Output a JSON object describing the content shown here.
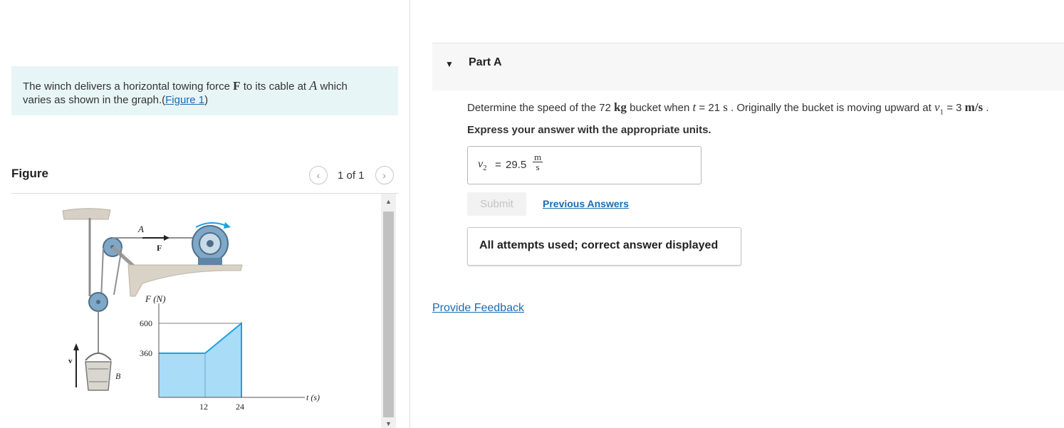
{
  "problem": {
    "text_before_F": "The winch delivers a horizontal towing force",
    "sym_F": "F",
    "text_mid": "to its cable at",
    "sym_A": "A",
    "text_line1_end": "which",
    "text_line2": "varies as shown in the graph.(",
    "figure_link": "Figure 1",
    "text_close": ")"
  },
  "figure_panel": {
    "title": "Figure",
    "pager_text": "1 of 1",
    "prev_icon": "chevron-left-icon",
    "next_icon": "chevron-right-icon"
  },
  "figure": {
    "label_A": "A",
    "label_F": "F",
    "label_FN": "F (N)",
    "label_v": "v",
    "label_B": "B",
    "y_tick_600": "600",
    "y_tick_360": "360",
    "x_tick_12": "12",
    "x_tick_24": "24",
    "x_axis_label": "t (s)"
  },
  "chart_data": {
    "type": "area",
    "x": [
      0,
      12,
      24
    ],
    "y": [
      360,
      360,
      600
    ],
    "xlabel": "t (s)",
    "ylabel": "F (N)",
    "x_ticks": [
      "12",
      "24"
    ],
    "y_ticks": [
      "600",
      "360"
    ],
    "fill_color": "#a8dcf7",
    "line_color": "#1ea0e0"
  },
  "part": {
    "caret_icon": "caret-down-icon",
    "title": "Part A"
  },
  "question": {
    "t1": "Determine the speed of the 72",
    "u_kg": "kg",
    "t2": "bucket when",
    "v_t": "t",
    "t3": "= 21",
    "u_s": "s",
    "t4": ". Originally the bucket is moving upward at",
    "v_v": "v",
    "v_sub": "1",
    "t5": "= 3",
    "u_ms": "m/s",
    "t6": "."
  },
  "instruction": "Express your answer with the appropriate units.",
  "answer": {
    "var": "v",
    "var_sub": "2",
    "eq": "=",
    "value": "29.5",
    "unit_num": "m",
    "unit_den": "s"
  },
  "submit_label": "Submit",
  "previous_answers_label": "Previous Answers",
  "attempts_message": "All attempts used; correct answer displayed",
  "feedback_label": "Provide Feedback",
  "colors": {
    "problem_bg": "#e8f5f7",
    "link": "#1a6bb0",
    "accent_blue": "#1ea0e0"
  }
}
